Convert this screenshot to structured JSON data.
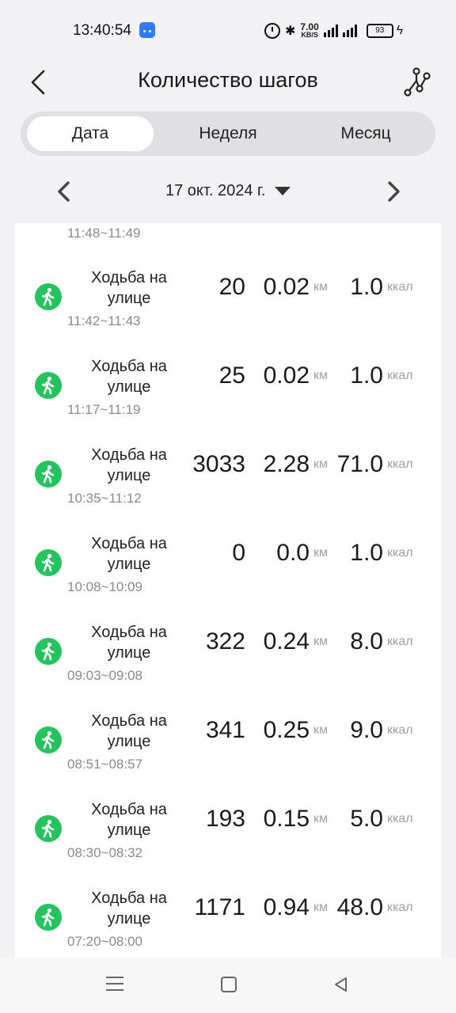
{
  "status_bar": {
    "time": "13:40:54",
    "net_speed_value": "7.00",
    "net_speed_unit": "KB/S",
    "battery": "93",
    "icons": [
      "android-icon",
      "alarm-icon",
      "bluetooth-icon",
      "signal-icon",
      "battery-icon",
      "charging-icon"
    ]
  },
  "header": {
    "title": "Количество шагов",
    "back_icon": "chevron-left-icon",
    "route_icon": "route-icon"
  },
  "tabs": [
    {
      "label": "Дата",
      "active": true
    },
    {
      "label": "Неделя",
      "active": false
    },
    {
      "label": "Месяц",
      "active": false
    }
  ],
  "date_nav": {
    "date": "17 окт. 2024 г."
  },
  "list": {
    "previous_time": "11:48~11:49",
    "rows": [
      {
        "activity": "Ходьба на улице",
        "time": "11:42~11:43",
        "steps": "20",
        "distance": "0.02",
        "distance_unit": "км",
        "kcal": "1.0",
        "kcal_unit": "ккал"
      },
      {
        "activity": "Ходьба на улице",
        "time": "11:17~11:19",
        "steps": "25",
        "distance": "0.02",
        "distance_unit": "км",
        "kcal": "1.0",
        "kcal_unit": "ккал"
      },
      {
        "activity": "Ходьба на улице",
        "time": "10:35~11:12",
        "steps": "3033",
        "distance": "2.28",
        "distance_unit": "км",
        "kcal": "71.0",
        "kcal_unit": "ккал"
      },
      {
        "activity": "Ходьба на улице",
        "time": "10:08~10:09",
        "steps": "0",
        "distance": "0.0",
        "distance_unit": "км",
        "kcal": "1.0",
        "kcal_unit": "ккал"
      },
      {
        "activity": "Ходьба на улице",
        "time": "09:03~09:08",
        "steps": "322",
        "distance": "0.24",
        "distance_unit": "км",
        "kcal": "8.0",
        "kcal_unit": "ккал"
      },
      {
        "activity": "Ходьба на улице",
        "time": "08:51~08:57",
        "steps": "341",
        "distance": "0.25",
        "distance_unit": "км",
        "kcal": "9.0",
        "kcal_unit": "ккал"
      },
      {
        "activity": "Ходьба на улице",
        "time": "08:30~08:32",
        "steps": "193",
        "distance": "0.15",
        "distance_unit": "км",
        "kcal": "5.0",
        "kcal_unit": "ккал"
      },
      {
        "activity": "Ходьба на улице",
        "time": "07:20~08:00",
        "steps": "1171",
        "distance": "0.94",
        "distance_unit": "км",
        "kcal": "48.0",
        "kcal_unit": "ккал"
      }
    ]
  },
  "colors": {
    "accent_green": "#25c35e",
    "background": "#f2f2f4",
    "secondary_text": "#8a8a8a"
  }
}
